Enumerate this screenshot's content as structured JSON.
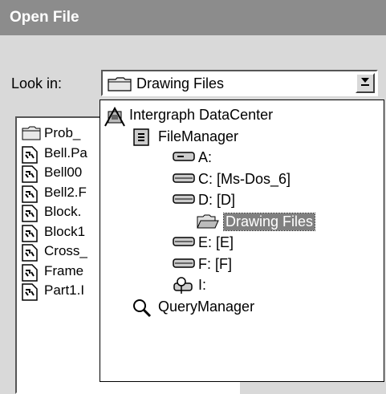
{
  "window": {
    "title": "Open File"
  },
  "look_in": {
    "label": "Look in:",
    "value": "Drawing Files",
    "dropdown_arrow": "down-arrow-icon"
  },
  "file_list": [
    {
      "name": "Prob_",
      "icon": "folder-icon"
    },
    {
      "name": "Bell.Pa",
      "icon": "file-icon"
    },
    {
      "name": "Bell00",
      "icon": "file-icon"
    },
    {
      "name": "Bell2.F",
      "icon": "file-icon"
    },
    {
      "name": "Block.",
      "icon": "file-icon"
    },
    {
      "name": "Block1",
      "icon": "file-icon"
    },
    {
      "name": "Cross_",
      "icon": "file-icon"
    },
    {
      "name": "Frame",
      "icon": "file-icon"
    },
    {
      "name": "Part1.I",
      "icon": "file-icon"
    }
  ],
  "dropdown": [
    {
      "label": "Intergraph DataCenter",
      "icon": "datacenter-icon"
    },
    {
      "label": "FileManager",
      "icon": "filemanager-icon"
    },
    {
      "label": "A:",
      "icon": "floppy-drive-icon"
    },
    {
      "label": "C: [Ms-Dos_6]",
      "icon": "hard-drive-icon"
    },
    {
      "label": "D: [D]",
      "icon": "hard-drive-icon"
    },
    {
      "label": "Drawing Files",
      "icon": "open-folder-icon",
      "selected": true
    },
    {
      "label": "E: [E]",
      "icon": "hard-drive-icon"
    },
    {
      "label": "F: [F]",
      "icon": "hard-drive-icon"
    },
    {
      "label": "I:",
      "icon": "network-drive-icon"
    },
    {
      "label": "QueryManager",
      "icon": "magnifier-icon"
    }
  ]
}
